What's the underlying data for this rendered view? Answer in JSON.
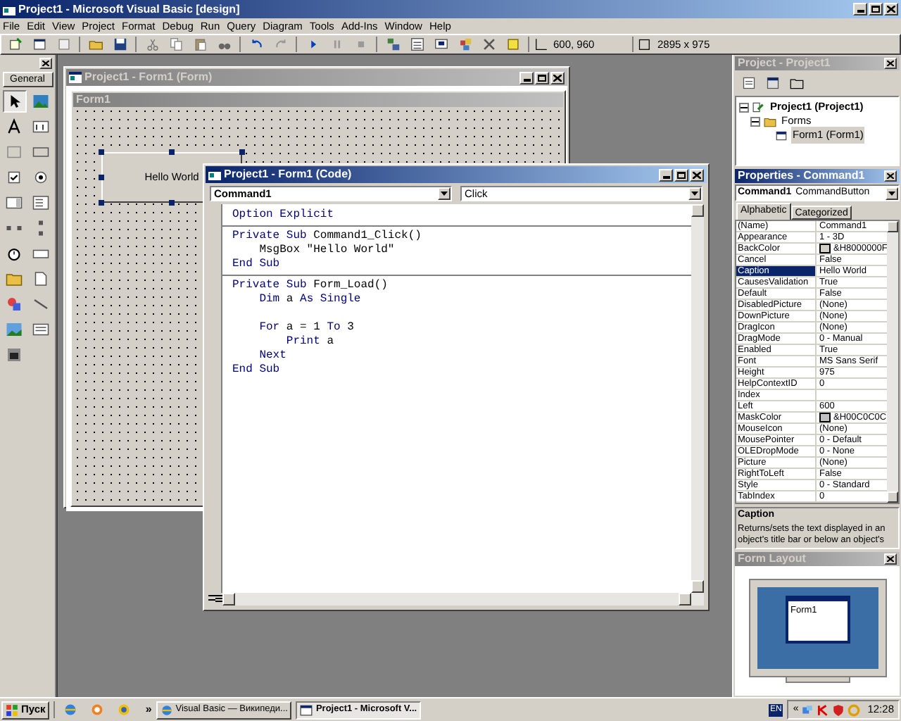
{
  "window": {
    "title": "Project1 - Microsoft Visual Basic [design]"
  },
  "menu": [
    "File",
    "Edit",
    "View",
    "Project",
    "Format",
    "Debug",
    "Run",
    "Query",
    "Diagram",
    "Tools",
    "Add-Ins",
    "Window",
    "Help"
  ],
  "toolbar": {
    "position": "600, 960",
    "size": "2895 x 975"
  },
  "toolbox": {
    "tab": "General"
  },
  "form_window": {
    "title": "Project1 - Form1 (Form)",
    "form_caption": "Form1",
    "button_caption": "Hello World"
  },
  "code_window": {
    "title": "Project1 - Form1 (Code)",
    "object": "Command1",
    "procedure": "Click",
    "lines": [
      {
        "kind": "code",
        "tokens": [
          {
            "kind": "keyword",
            "text": "Option Explicit"
          }
        ]
      },
      {
        "kind": "separator"
      },
      {
        "kind": "code",
        "tokens": [
          {
            "kind": "keyword",
            "text": "Private Sub"
          },
          {
            "kind": "plain",
            "text": " Command1_Click()"
          }
        ]
      },
      {
        "kind": "code",
        "tokens": [
          {
            "kind": "plain",
            "text": "    MsgBox \"Hello World\""
          }
        ]
      },
      {
        "kind": "code",
        "tokens": [
          {
            "kind": "keyword",
            "text": "End Sub"
          }
        ]
      },
      {
        "kind": "separator"
      },
      {
        "kind": "code",
        "tokens": [
          {
            "kind": "keyword",
            "text": "Private Sub"
          },
          {
            "kind": "plain",
            "text": " Form_Load()"
          }
        ]
      },
      {
        "kind": "code",
        "tokens": [
          {
            "kind": "keyword",
            "text": "    Dim"
          },
          {
            "kind": "plain",
            "text": " a "
          },
          {
            "kind": "keyword",
            "text": "As Single"
          }
        ]
      },
      {
        "kind": "blank"
      },
      {
        "kind": "code",
        "tokens": [
          {
            "kind": "keyword",
            "text": "    For"
          },
          {
            "kind": "plain",
            "text": " a = 1 "
          },
          {
            "kind": "keyword",
            "text": "To"
          },
          {
            "kind": "plain",
            "text": " 3"
          }
        ]
      },
      {
        "kind": "code",
        "tokens": [
          {
            "kind": "keyword",
            "text": "        Print"
          },
          {
            "kind": "plain",
            "text": " a"
          }
        ]
      },
      {
        "kind": "code",
        "tokens": [
          {
            "kind": "keyword",
            "text": "    Next"
          }
        ]
      },
      {
        "kind": "code",
        "tokens": [
          {
            "kind": "keyword",
            "text": "End Sub"
          }
        ]
      }
    ]
  },
  "project_panel": {
    "title": "Project - Project1",
    "tree": [
      {
        "label": "Project1 (Project1)",
        "expanded": true,
        "selected": false,
        "children": [
          {
            "label": "Forms",
            "expanded": true,
            "selected": false,
            "children": [
              {
                "label": "Form1 (Form1)",
                "selected": true
              }
            ]
          }
        ]
      }
    ]
  },
  "properties_panel": {
    "title": "Properties - Command1",
    "object": "Command1",
    "object_type": "CommandButton",
    "tabs": [
      {
        "label": "Alphabetic",
        "selected": true
      },
      {
        "label": "Categorized",
        "selected": false
      }
    ],
    "rows": [
      {
        "name": "(Name)",
        "value": "Command1",
        "selected": false
      },
      {
        "name": "Appearance",
        "value": "1 - 3D",
        "selected": false
      },
      {
        "name": "BackColor",
        "value": "&H8000000F",
        "color": "#d4d0c8",
        "selected": false
      },
      {
        "name": "Cancel",
        "value": "False",
        "selected": false
      },
      {
        "name": "Caption",
        "value": "Hello World",
        "selected": true
      },
      {
        "name": "CausesValidation",
        "value": "True",
        "selected": false
      },
      {
        "name": "Default",
        "value": "False",
        "selected": false
      },
      {
        "name": "DisabledPicture",
        "value": "(None)",
        "selected": false
      },
      {
        "name": "DownPicture",
        "value": "(None)",
        "selected": false
      },
      {
        "name": "DragIcon",
        "value": "(None)",
        "selected": false
      },
      {
        "name": "DragMode",
        "value": "0 - Manual",
        "selected": false
      },
      {
        "name": "Enabled",
        "value": "True",
        "selected": false
      },
      {
        "name": "Font",
        "value": "MS Sans Serif",
        "selected": false
      },
      {
        "name": "Height",
        "value": "975",
        "selected": false
      },
      {
        "name": "HelpContextID",
        "value": "0",
        "selected": false
      },
      {
        "name": "Index",
        "selected": false
      },
      {
        "name": "Left",
        "value": "600",
        "selected": false
      },
      {
        "name": "MaskColor",
        "value": "&H00C0C0C",
        "color": "#c0c0c0",
        "selected": false
      },
      {
        "name": "MouseIcon",
        "value": "(None)",
        "selected": false
      },
      {
        "name": "MousePointer",
        "value": "0 - Default",
        "selected": false
      },
      {
        "name": "OLEDropMode",
        "value": "0 - None",
        "selected": false
      },
      {
        "name": "Picture",
        "value": "(None)",
        "selected": false
      },
      {
        "name": "RightToLeft",
        "value": "False",
        "selected": false
      },
      {
        "name": "Style",
        "value": "0 - Standard",
        "selected": false
      },
      {
        "name": "TabIndex",
        "value": "0",
        "selected": false
      }
    ],
    "description_title": "Caption",
    "description": "Returns/sets the text displayed in an object's title bar or below an object's"
  },
  "form_layout": {
    "title": "Form Layout",
    "form_caption": "Form1"
  },
  "taskbar": {
    "start": "Пуск",
    "overflow": "»",
    "tasks": [
      {
        "label": "Visual Basic — Википеди...",
        "selected": false
      },
      {
        "label": "Project1 - Microsoft V...",
        "selected": true
      }
    ],
    "language": "EN",
    "tray_overflow": "«",
    "clock": "12:28"
  }
}
